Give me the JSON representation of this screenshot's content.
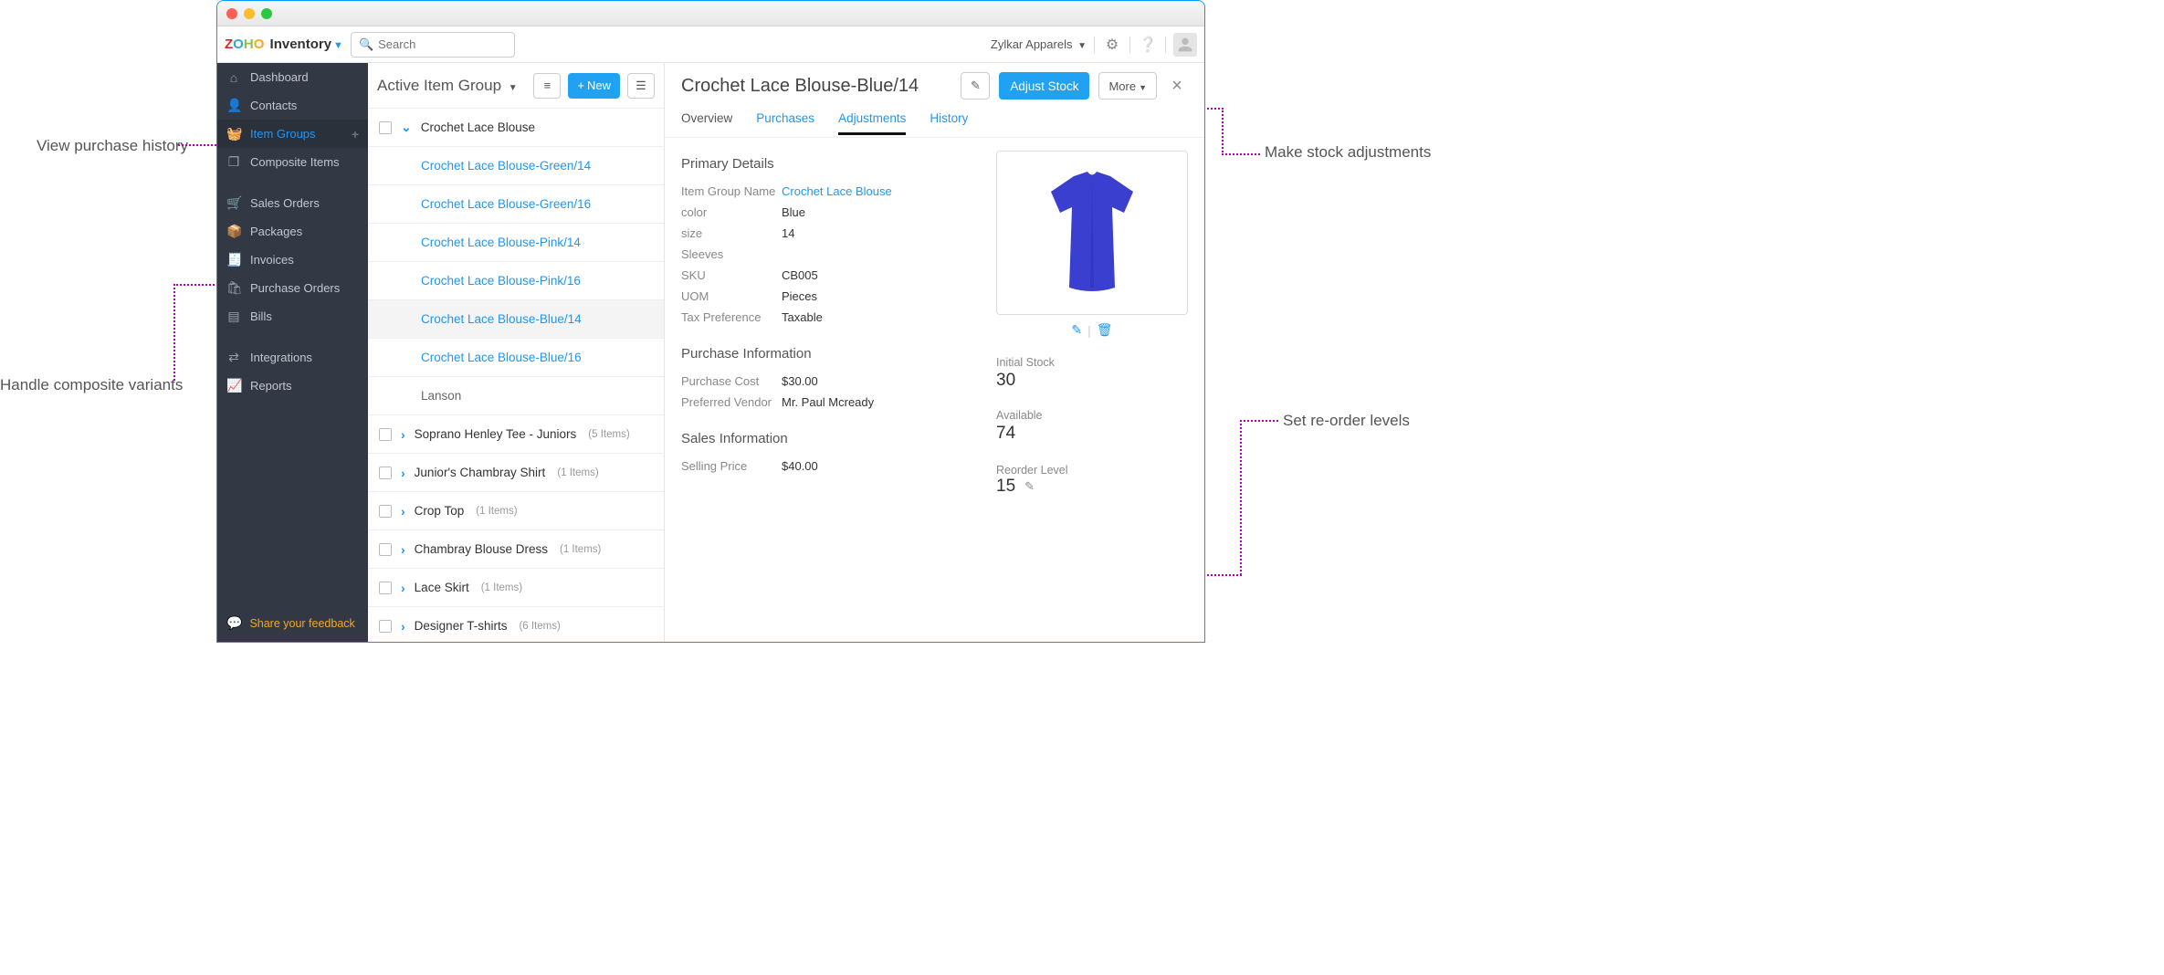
{
  "header": {
    "brand": "Inventory",
    "search_placeholder": "Search",
    "org_name": "Zylkar Apparels"
  },
  "sidebar": {
    "items": [
      {
        "icon": "home",
        "label": "Dashboard"
      },
      {
        "icon": "user",
        "label": "Contacts"
      },
      {
        "icon": "basket",
        "label": "Item Groups",
        "active": true,
        "plus": true
      },
      {
        "icon": "cube",
        "label": "Composite Items"
      }
    ],
    "items2": [
      {
        "icon": "cart",
        "label": "Sales Orders"
      },
      {
        "icon": "box",
        "label": "Packages"
      },
      {
        "icon": "doc",
        "label": "Invoices"
      },
      {
        "icon": "bag",
        "label": "Purchase Orders"
      },
      {
        "icon": "bill",
        "label": "Bills"
      }
    ],
    "items3": [
      {
        "icon": "plug",
        "label": "Integrations"
      },
      {
        "icon": "chart",
        "label": "Reports"
      }
    ],
    "feedback": "Share your feedback"
  },
  "midpanel": {
    "title": "Active Item Group",
    "new_label": "New",
    "groups": {
      "open": {
        "name": "Crochet Lace Blouse",
        "variants": [
          "Crochet Lace Blouse-Green/14",
          "Crochet Lace Blouse-Green/16",
          "Crochet Lace Blouse-Pink/14",
          "Crochet Lace Blouse-Pink/16",
          "Crochet Lace Blouse-Blue/14",
          "Crochet Lace Blouse-Blue/16",
          "Lanson"
        ],
        "selected_index": 4
      },
      "closed": [
        {
          "name": "Soprano Henley Tee - Juniors",
          "meta": "(5 Items)"
        },
        {
          "name": "Junior's Chambray Shirt",
          "meta": "(1 Items)"
        },
        {
          "name": "Crop Top",
          "meta": "(1 Items)"
        },
        {
          "name": "Chambray Blouse Dress",
          "meta": "(1 Items)"
        },
        {
          "name": "Lace Skirt",
          "meta": "(1 Items)"
        },
        {
          "name": "Designer T-shirts",
          "meta": "(6 Items)"
        }
      ]
    }
  },
  "detail": {
    "title": "Crochet Lace Blouse-Blue/14",
    "adjust_label": "Adjust Stock",
    "more_label": "More",
    "tabs": [
      "Overview",
      "Purchases",
      "Adjustments",
      "History"
    ],
    "active_tab": 2,
    "primary_header": "Primary Details",
    "primary": [
      {
        "k": "Item Group Name",
        "v": "Crochet Lace Blouse",
        "link": true
      },
      {
        "k": "color",
        "v": "Blue"
      },
      {
        "k": "size",
        "v": "14"
      },
      {
        "k": "Sleeves",
        "v": ""
      },
      {
        "k": "SKU",
        "v": "CB005"
      },
      {
        "k": "UOM",
        "v": "Pieces"
      },
      {
        "k": "Tax Preference",
        "v": "Taxable"
      }
    ],
    "purchase_header": "Purchase Information",
    "purchase": [
      {
        "k": "Purchase Cost",
        "v": "$30.00"
      },
      {
        "k": "Preferred Vendor",
        "v": "Mr. Paul Mcready"
      }
    ],
    "sales_header": "Sales Information",
    "sales": [
      {
        "k": "Selling Price",
        "v": "$40.00"
      }
    ],
    "stock": {
      "initial_label": "Initial Stock",
      "initial": "30",
      "avail_label": "Available",
      "avail": "74",
      "reorder_label": "Reorder Level",
      "reorder": "15"
    }
  },
  "annotations": {
    "a1": "View purchase history",
    "a2": "Handle composite variants",
    "a3": "Make stock adjustments",
    "a4": "Set re-order levels"
  }
}
